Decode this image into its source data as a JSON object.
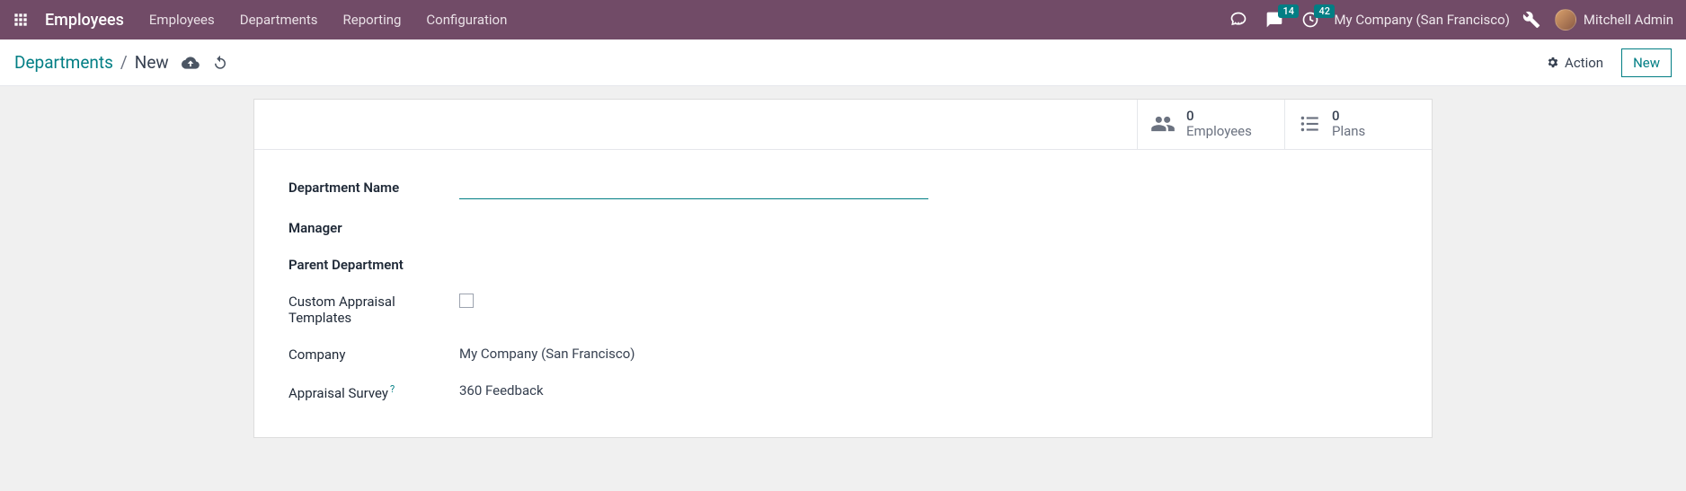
{
  "topbar": {
    "app_title": "Employees",
    "nav": [
      "Employees",
      "Departments",
      "Reporting",
      "Configuration"
    ],
    "messages_badge": "14",
    "activities_badge": "42",
    "company": "My Company (San Francisco)",
    "username": "Mitchell Admin"
  },
  "control": {
    "crumb_root": "Departments",
    "crumb_current": "New",
    "action_label": "Action",
    "new_label": "New"
  },
  "stats": {
    "employees_count": "0",
    "employees_label": "Employees",
    "plans_count": "0",
    "plans_label": "Plans"
  },
  "form": {
    "labels": {
      "name": "Department Name",
      "manager": "Manager",
      "parent": "Parent Department",
      "custom_appraisal": "Custom Appraisal Templates",
      "company": "Company",
      "appraisal_survey": "Appraisal Survey"
    },
    "values": {
      "name": "",
      "company": "My Company (San Francisco)",
      "appraisal_survey": "360 Feedback"
    },
    "help_marker": "?"
  }
}
